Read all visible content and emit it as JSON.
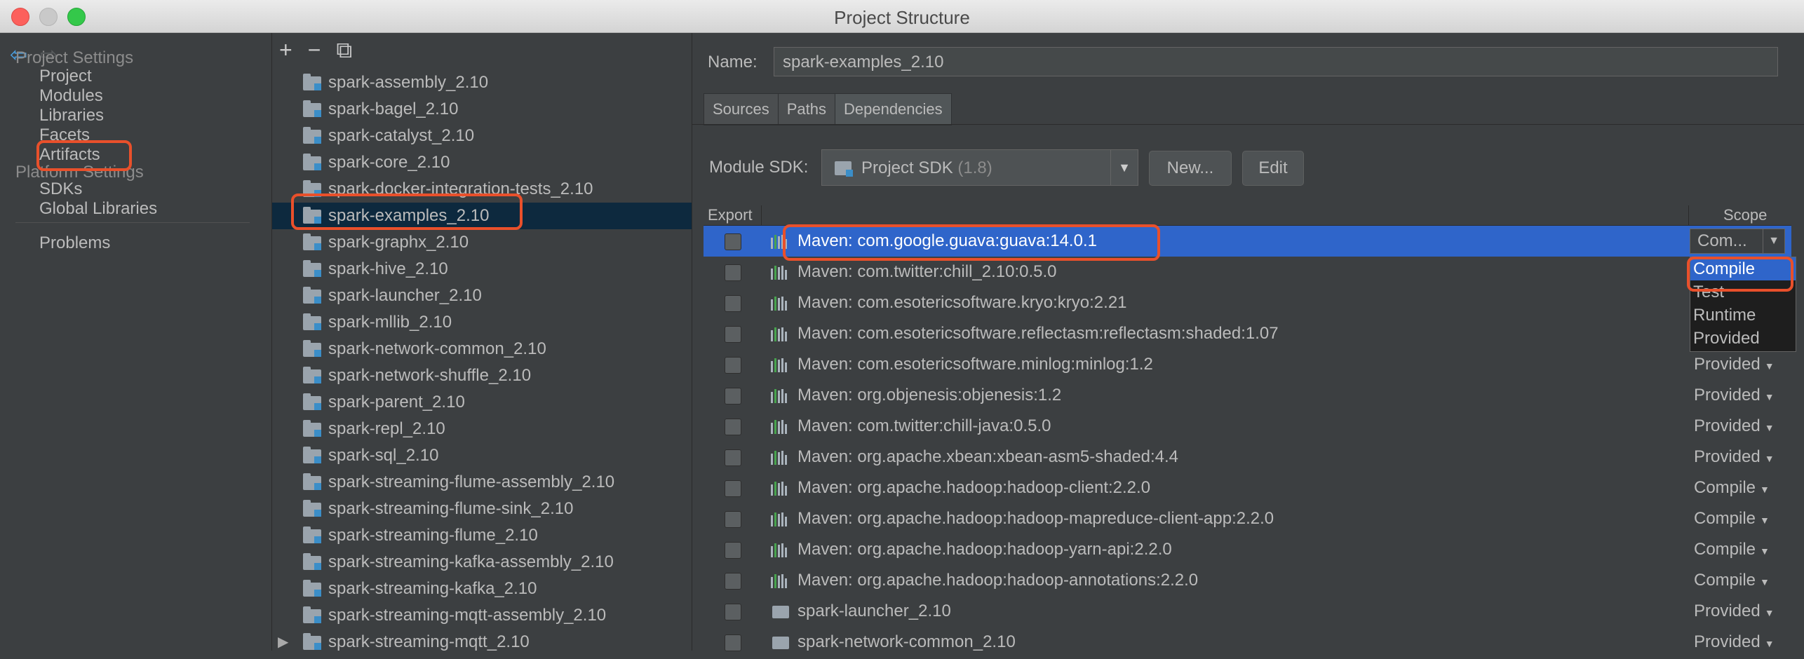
{
  "window": {
    "title": "Project Structure"
  },
  "nav": {
    "project_settings_label": "Project Settings",
    "items_project": [
      "Project",
      "Modules",
      "Libraries",
      "Facets",
      "Artifacts"
    ],
    "platform_settings_label": "Platform Settings",
    "items_platform": [
      "SDKs",
      "Global Libraries"
    ],
    "problems": "Problems"
  },
  "modules": {
    "toolbar": {
      "add": "+",
      "remove": "−",
      "copy": "⧉"
    },
    "items": [
      "spark-assembly_2.10",
      "spark-bagel_2.10",
      "spark-catalyst_2.10",
      "spark-core_2.10",
      "spark-docker-integration-tests_2.10",
      "spark-examples_2.10",
      "spark-graphx_2.10",
      "spark-hive_2.10",
      "spark-launcher_2.10",
      "spark-mllib_2.10",
      "spark-network-common_2.10",
      "spark-network-shuffle_2.10",
      "spark-parent_2.10",
      "spark-repl_2.10",
      "spark-sql_2.10",
      "spark-streaming-flume-assembly_2.10",
      "spark-streaming-flume-sink_2.10",
      "spark-streaming-flume_2.10",
      "spark-streaming-kafka-assembly_2.10",
      "spark-streaming-kafka_2.10",
      "spark-streaming-mqtt-assembly_2.10",
      "spark-streaming-mqtt_2.10"
    ],
    "selected": "spark-examples_2.10"
  },
  "detail": {
    "name_label": "Name:",
    "name_value": "spark-examples_2.10",
    "tabs": [
      "Sources",
      "Paths",
      "Dependencies"
    ],
    "active_tab": "Dependencies",
    "sdk_label": "Module SDK:",
    "sdk_value": "Project SDK",
    "sdk_version": "(1.8)",
    "new_button": "New...",
    "edit_button": "Edit",
    "table": {
      "col_export": "Export",
      "col_scope": "Scope",
      "rows": [
        {
          "name": "Maven: com.google.guava:guava:14.0.1",
          "scope": "Com...",
          "kind": "lib"
        },
        {
          "name": "Maven: com.twitter:chill_2.10:0.5.0",
          "scope": "",
          "kind": "lib"
        },
        {
          "name": "Maven: com.esotericsoftware.kryo:kryo:2.21",
          "scope": "",
          "kind": "lib"
        },
        {
          "name": "Maven: com.esotericsoftware.reflectasm:reflectasm:shaded:1.07",
          "scope": "",
          "kind": "lib"
        },
        {
          "name": "Maven: com.esotericsoftware.minlog:minlog:1.2",
          "scope": "Provided",
          "kind": "lib"
        },
        {
          "name": "Maven: org.objenesis:objenesis:1.2",
          "scope": "Provided",
          "kind": "lib"
        },
        {
          "name": "Maven: com.twitter:chill-java:0.5.0",
          "scope": "Provided",
          "kind": "lib"
        },
        {
          "name": "Maven: org.apache.xbean:xbean-asm5-shaded:4.4",
          "scope": "Provided",
          "kind": "lib"
        },
        {
          "name": "Maven: org.apache.hadoop:hadoop-client:2.2.0",
          "scope": "Compile",
          "kind": "lib"
        },
        {
          "name": "Maven: org.apache.hadoop:hadoop-mapreduce-client-app:2.2.0",
          "scope": "Compile",
          "kind": "lib"
        },
        {
          "name": "Maven: org.apache.hadoop:hadoop-yarn-api:2.2.0",
          "scope": "Compile",
          "kind": "lib"
        },
        {
          "name": "Maven: org.apache.hadoop:hadoop-annotations:2.2.0",
          "scope": "Compile",
          "kind": "lib"
        },
        {
          "name": "spark-launcher_2.10",
          "scope": "Provided",
          "kind": "module"
        },
        {
          "name": "spark-network-common_2.10",
          "scope": "Provided",
          "kind": "module"
        }
      ]
    },
    "scope_popup": [
      "Compile",
      "Test",
      "Runtime",
      "Provided"
    ],
    "scope_popup_selected": "Compile"
  },
  "colors": {
    "highlight": "#e9502b",
    "selection": "#2f65ca",
    "tree_selection": "#0d293e"
  }
}
